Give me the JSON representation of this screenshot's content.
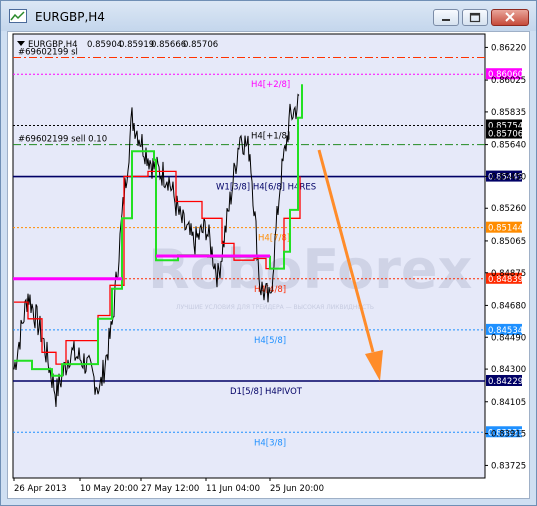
{
  "window": {
    "title": "EURGBP,H4"
  },
  "chart_data": {
    "type": "line",
    "symbol": "EURGBP,H4",
    "ohlc": {
      "open": "0.85904",
      "high": "0.85919",
      "low": "0.85666",
      "close": "0.85706"
    },
    "ylim": [
      0.8365,
      0.863
    ],
    "y_ticks": [
      "0.86220",
      "0.86025",
      "0.85835",
      "0.85640",
      "0.85450",
      "0.85260",
      "0.85065",
      "0.84875",
      "0.84680",
      "0.84490",
      "0.84300",
      "0.84105",
      "0.83915",
      "0.83725"
    ],
    "x_ticks": [
      "26 Apr 2013",
      "10 May 20:00",
      "27 May 12:00",
      "11 Jun 04:00",
      "25 Jun 20:00"
    ],
    "levels": [
      {
        "label": "H4[+2/8]",
        "value": 0.8606,
        "price_tag": "0.86060",
        "color": "#ff00ff"
      },
      {
        "label": "H4[+1/8]",
        "value": 0.85754,
        "price_tag": "0.85754",
        "color": "#000000"
      },
      {
        "label": "W1[3/8] H4[6/8] H4RES",
        "value": 0.85449,
        "price_tag": "0.85449",
        "color": "#000066"
      },
      {
        "label": "H4[7/8]",
        "value": 0.85144,
        "price_tag": "0.85144",
        "color": "#ff8c00"
      },
      {
        "label": "H4[4/8]",
        "value": 0.84839,
        "price_tag": "0.84839",
        "color": "#ff2a00"
      },
      {
        "label": "H4[5/8]",
        "value": 0.84534,
        "price_tag": "0.84534",
        "color": "#1e90ff"
      },
      {
        "label": "D1[5/8] H4PIVOT",
        "value": 0.84229,
        "price_tag": "0.84229",
        "color": "#000066"
      },
      {
        "label": "H4[3/8]",
        "value": 0.83923,
        "price_tag": "0.83923",
        "color": "#1e90ff"
      }
    ],
    "order_lines": [
      {
        "label": "#69602199 sl",
        "value": 0.8616
      },
      {
        "label": "#69602199 sell 0.10",
        "value": 0.8564
      }
    ],
    "current_price_tag": "0.85706",
    "watermark": "RoboForex",
    "watermark_sub": "ЛУЧШИЕ УСЛОВИЯ ДЛЯ ТРЕЙДЕРА — ВЫСОКАЯ ЛИКВИДНОСТЬ"
  }
}
